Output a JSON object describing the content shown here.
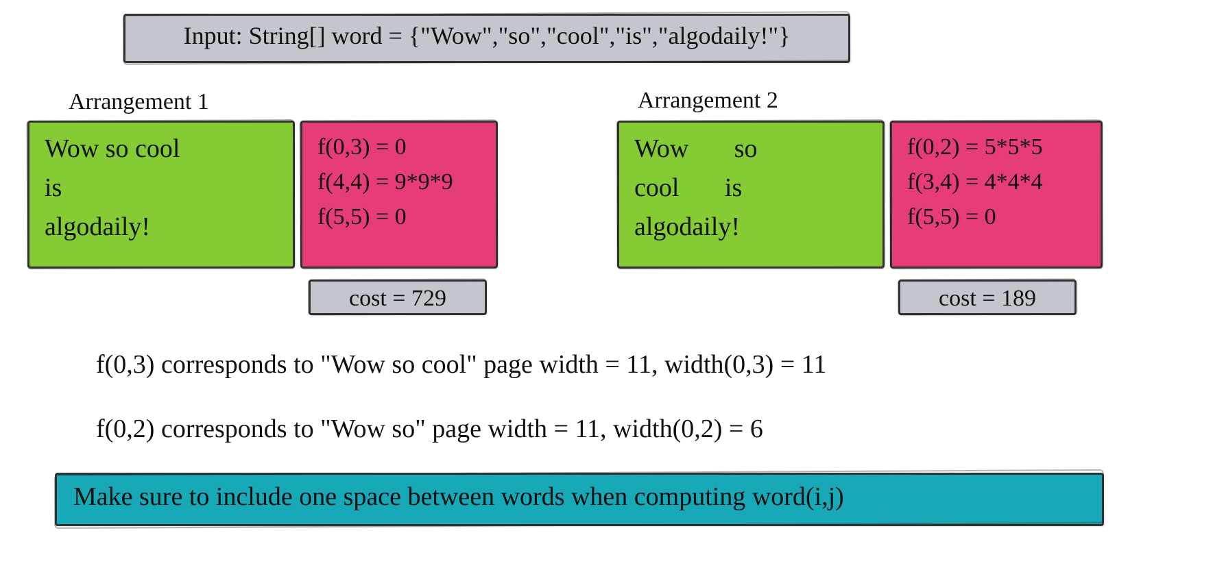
{
  "input_box": "Input: String[] word = {\"Wow\",\"so\",\"cool\",\"is\",\"algodaily!\"}",
  "arr1": {
    "label": "Arrangement 1",
    "words": "Wow so cool\nis\nalgodaily!",
    "calc": "f(0,3) = 0\nf(4,4) = 9*9*9\nf(5,5) = 0",
    "cost": "cost = 729"
  },
  "arr2": {
    "label": "Arrangement 2",
    "words": "Wow       so\ncool       is\nalgodaily!",
    "calc": "f(0,2) = 5*5*5\nf(3,4) = 4*4*4\nf(5,5) = 0",
    "cost": "cost = 189"
  },
  "expl1": "f(0,3) corresponds to \"Wow so cool\" page width = 11, width(0,3) = 11",
  "expl2": "f(0,2) corresponds to \"Wow so\" page width = 11, width(0,2) = 6",
  "note": "Make sure to include one space between words when computing word(i,j)"
}
